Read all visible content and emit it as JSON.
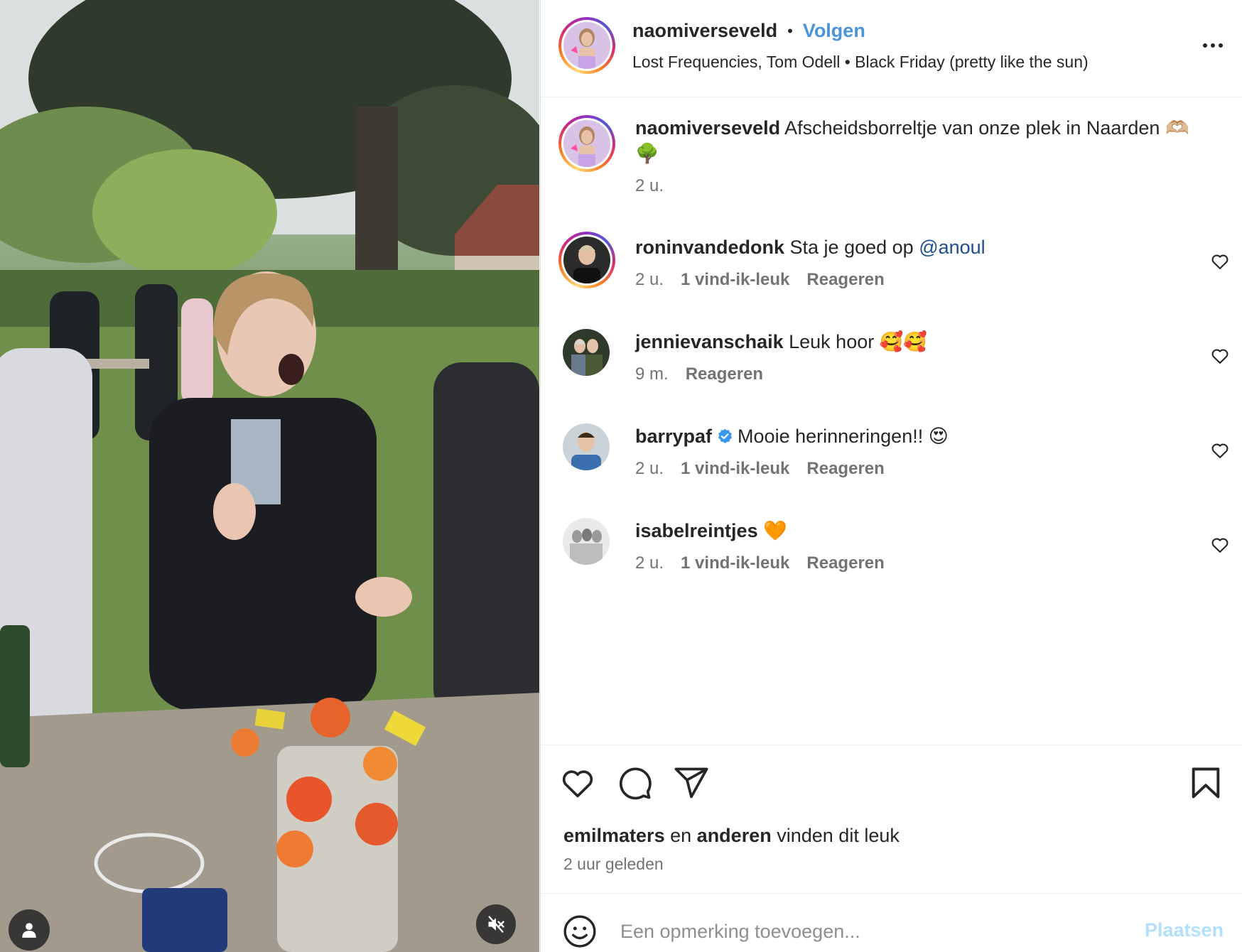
{
  "post": {
    "username": "naomiverseveld",
    "follow_label": "Volgen",
    "separator": "•",
    "audio": "Lost Frequencies, Tom Odell • Black Friday (pretty like the sun)",
    "caption_text": "Afscheidsborreltje van onze plek in Naarden",
    "caption_emoji": "🫶🏼🌳",
    "caption_time": "2 u.",
    "likes_user": "emilmaters",
    "likes_conj": "en",
    "likes_others": "anderen",
    "likes_suffix": "vinden dit leuk",
    "posted_ago": "2 uur geleden"
  },
  "comments": [
    {
      "username": "roninvandedonk",
      "text": "Sta je goed op",
      "mention": "@anoul",
      "time": "2 u.",
      "likes": "1 vind-ik-leuk",
      "reply": "Reageren"
    },
    {
      "username": "jennievanschaik",
      "text": "Leuk hoor 🥰🥰",
      "time": "9 m.",
      "reply": "Reageren"
    },
    {
      "username": "barrypaf",
      "text": "Mooie herinneringen!! 😍",
      "time": "2 u.",
      "likes": "1 vind-ik-leuk",
      "reply": "Reageren"
    },
    {
      "username": "isabelreintjes",
      "text": "🧡",
      "time": "2 u.",
      "likes": "1 vind-ik-leuk",
      "reply": "Reageren"
    }
  ],
  "composer": {
    "placeholder": "Een opmerking toevoegen...",
    "post_label": "Plaatsen"
  },
  "icons": {
    "more": "more-horizontal-icon",
    "like": "heart-icon",
    "comment": "comment-bubble-icon",
    "share": "paper-plane-icon",
    "save": "bookmark-icon",
    "emoji": "smiley-icon",
    "mute": "speaker-muted-icon",
    "tags": "user-icon",
    "verified": "verified-badge-icon"
  },
  "colors": {
    "accent": "#4a94d8",
    "mention": "#1f4e8c",
    "muted_text": "#737373",
    "post_button_disabled": "#b2dffc"
  }
}
